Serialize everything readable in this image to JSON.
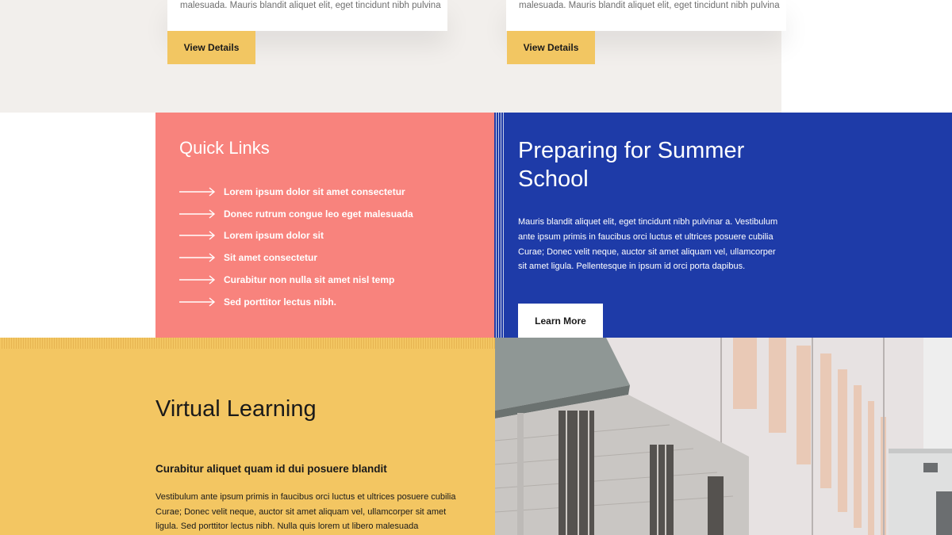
{
  "cards": [
    {
      "text": "malesuada. Mauris blandit aliquet elit, eget tincidunt nibh pulvina",
      "button": "View Details"
    },
    {
      "text": "malesuada. Mauris blandit aliquet elit, eget tincidunt nibh pulvina",
      "button": "View Details"
    }
  ],
  "quick_links": {
    "title": "Quick Links",
    "items": [
      "Lorem ipsum dolor sit amet consectetur",
      "Donec rutrum congue leo eget malesuada",
      "Lorem ipsum dolor sit",
      "Sit amet consectetur",
      "Curabitur non nulla sit amet nisl temp",
      "Sed porttitor lectus nibh."
    ]
  },
  "summer": {
    "title": "Preparing for Summer School",
    "text": "Mauris blandit aliquet elit, eget tincidunt nibh pulvinar a. Vestibulum ante ipsum primis in faucibus orci luctus et ultrices posuere cubilia Curae; Donec velit neque, auctor sit amet aliquam vel, ullamcorper sit amet ligula. Pellentesque in ipsum id orci porta dapibus.",
    "button": "Learn More"
  },
  "virtual": {
    "title": "Virtual Learning",
    "subtitle": "Curabitur aliquet quam id dui posuere blandit",
    "text": "Vestibulum ante ipsum primis in faucibus orci luctus et ultrices posuere cubilia Curae; Donec velit neque, auctor sit amet aliquam vel, ullamcorper sit amet ligula. Sed porttitor lectus nibh. Nulla quis lorem ut libero malesuada"
  },
  "colors": {
    "coral": "#f8837d",
    "blue": "#1e3ba8",
    "yellow": "#f3c662",
    "beige": "#f2efec"
  }
}
